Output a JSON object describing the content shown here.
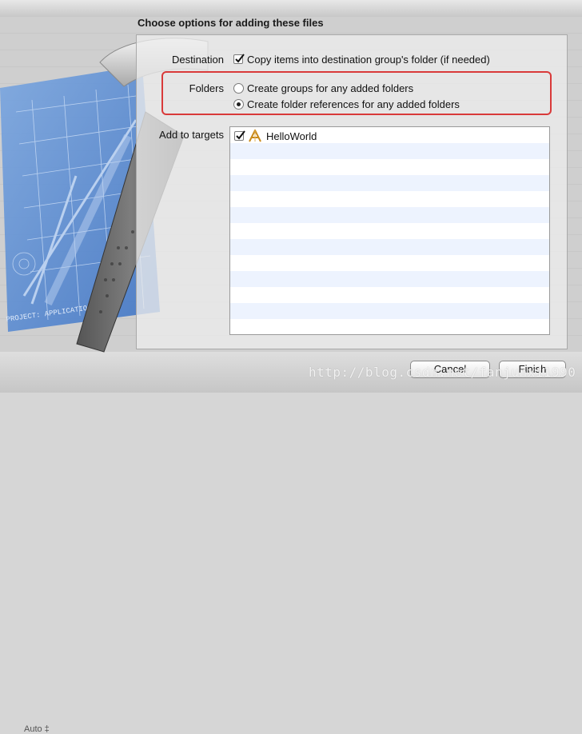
{
  "dialog": {
    "title": "Choose options for adding these files",
    "destination": {
      "label": "Destination",
      "checkbox_label": "Copy items into destination group's folder (if needed)",
      "checked": true
    },
    "folders": {
      "label": "Folders",
      "options": [
        {
          "label": "Create groups for any added folders",
          "selected": false
        },
        {
          "label": "Create folder references for any added folders",
          "selected": true
        }
      ]
    },
    "targets": {
      "label": "Add to targets",
      "items": [
        {
          "name": "HelloWorld",
          "checked": true,
          "icon": "app-target-icon"
        }
      ]
    },
    "buttons": {
      "cancel": "Cancel",
      "finish": "Finish"
    }
  },
  "background": {
    "zoom": "Auto ‡",
    "blueprint_caption": "PROJECT: APPLICATION.APP"
  },
  "watermark": "http://blog.csdn.net/fanjunxi1990",
  "colors": {
    "highlight": "#d93a3a",
    "blueprint": "#5b8fd6"
  }
}
